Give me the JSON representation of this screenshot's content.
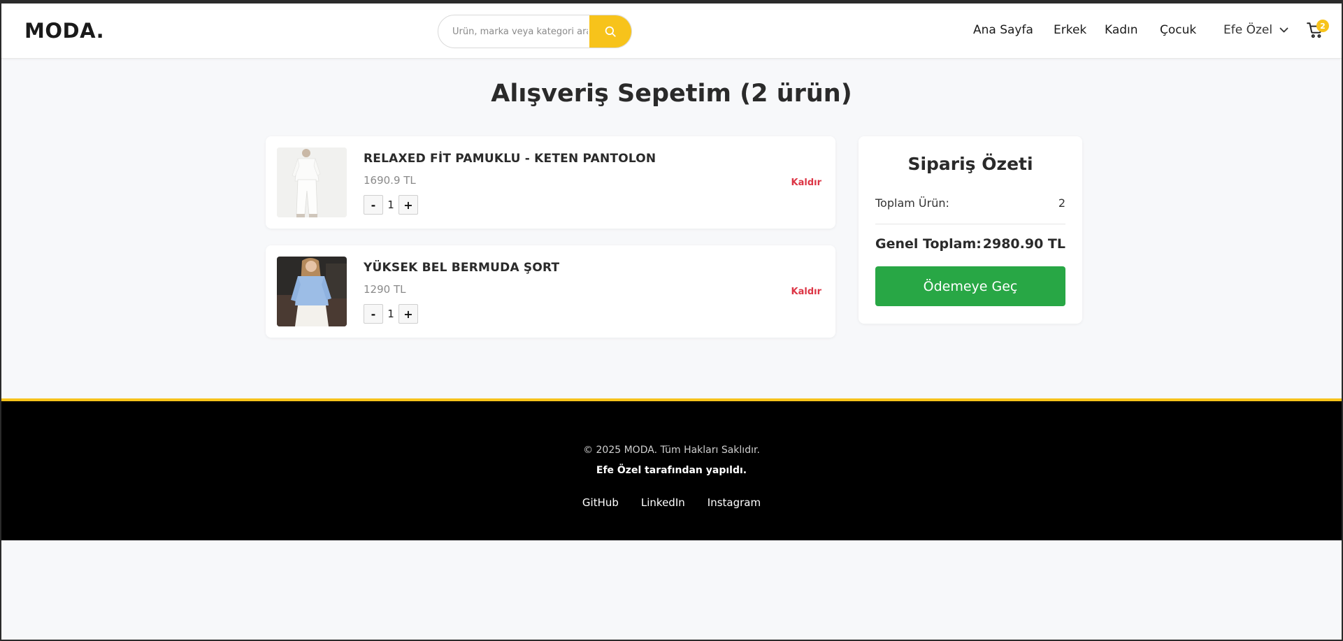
{
  "header": {
    "logo": "MODA.",
    "search": {
      "placeholder": "Ürün, marka veya kategori ara"
    },
    "nav": [
      "Ana Sayfa",
      "Erkek",
      "Kadın",
      "Çocuk"
    ],
    "user": "Efe Özel",
    "cart_count": "2"
  },
  "page_title": "Alışveriş Sepetim (2 ürün)",
  "cart": {
    "items": [
      {
        "name": "RELAXED FİT PAMUKLU - KETEN PANTOLON",
        "price": "1690.9 TL",
        "quantity": "1",
        "remove_label": "Kaldır"
      },
      {
        "name": "YÜKSEK BEL BERMUDA ŞORT",
        "price": "1290 TL",
        "quantity": "1",
        "remove_label": "Kaldır"
      }
    ],
    "minus_label": "-",
    "plus_label": "+"
  },
  "summary": {
    "title": "Sipariş Özeti",
    "total_items_label": "Toplam Ürün:",
    "total_items_value": "2",
    "grand_total_label": "Genel Toplam:",
    "grand_total_value": "2980.90 TL",
    "checkout_label": "Ödemeye Geç"
  },
  "footer": {
    "copyright": "© 2025 MODA. Tüm Hakları Saklıdır.",
    "credit": "Efe Özel tarafından yapıldı.",
    "links": [
      "GitHub",
      "LinkedIn",
      "Instagram"
    ]
  },
  "colors": {
    "accent": "#f7c31b",
    "checkout": "#28a745",
    "remove": "#dc3545",
    "footer_bg": "#000000"
  },
  "icons": {
    "search": "search-icon",
    "user_dropdown": "chevron-down-icon",
    "cart": "cart-icon"
  }
}
